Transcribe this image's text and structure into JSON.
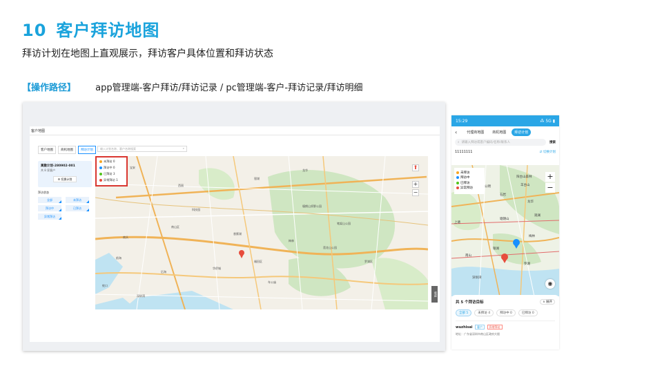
{
  "header": {
    "number": "10",
    "title": "客户拜访地图",
    "subtitle": "拜访计划在地图上直观展示，拜访客户具体位置和拜访状态",
    "path_label": "【操作路径】",
    "path_text": "app管理端-客户拜访/拜访记录 / pc管理端-客户-拜访记录/拜访明细"
  },
  "desktop": {
    "page_title": "客户地图",
    "tabs": [
      {
        "label": "客户地图",
        "active": false
      },
      {
        "label": "商机地图",
        "active": false
      },
      {
        "label": "拜访计划",
        "active": true
      }
    ],
    "search_placeholder": "输入计划名称、客户名称搜索",
    "plan": {
      "name": "离散计划-280902-001",
      "count": "共 8 家客户",
      "switch_label": "⚙ 切换计划"
    },
    "visit_status_label": "拜访状态",
    "status_chips": [
      "全部",
      "未拜访",
      "拜访中",
      "已拜访",
      "异常拜访"
    ],
    "legend": [
      {
        "label": "未拜访 0",
        "color": "#f5a623"
      },
      {
        "label": "拜访中 0",
        "color": "#1890ff"
      },
      {
        "label": "已拜访 3",
        "color": "#52c41a"
      },
      {
        "label": "异常拜访 1",
        "color": "#e74c3c"
      }
    ],
    "map_labels": [
      "宝安",
      "福田区",
      "南山区",
      "罗湖区",
      "深圳湾",
      "后海",
      "前海",
      "西丽",
      "龙华",
      "塘朗山郊野公园",
      "梅林",
      "香蜜湖",
      "南头",
      "蛇口",
      "科技园",
      "华侨城",
      "车公庙",
      "银湖",
      "笔架山公园",
      "莲花山公园"
    ],
    "side_button": "收起"
  },
  "phone": {
    "time": "15:29",
    "signal": "⁂ 5G ▮",
    "tabs": [
      {
        "label": "代理商地图",
        "active": false
      },
      {
        "label": "商机地图",
        "active": false
      },
      {
        "label": "拜访计划",
        "active": true
      }
    ],
    "search_placeholder": "请输入拜访或客户编码/名称/联系人",
    "search_button": "搜索",
    "plan_name": "11111111",
    "switch_plan": "⇄ 切换计划",
    "legend": [
      {
        "label": "未拜访",
        "color": "#f5a623"
      },
      {
        "label": "拜访中",
        "color": "#1890ff"
      },
      {
        "label": "已拜访",
        "color": "#52c41a"
      },
      {
        "label": "异常拜访",
        "color": "#e74c3c"
      }
    ],
    "map_labels": [
      "阳台山森林",
      "羊台山",
      "公明",
      "石岩",
      "龙华",
      "罗湖",
      "南山",
      "深圳湾",
      "塘朗山",
      "观澜",
      "梅林",
      "上塘",
      "银湖"
    ],
    "panel_title": "共 5 个拜访目标",
    "expand_label": "∧ 展开",
    "filters": [
      {
        "label": "全部 5",
        "active": true
      },
      {
        "label": "未拜访 4",
        "active": false
      },
      {
        "label": "拜访中 0",
        "active": false
      },
      {
        "label": "已拜访 0",
        "active": false
      }
    ],
    "card": {
      "name": "wuzhisai",
      "tag1": "客户",
      "tag2": "异常拜访",
      "address": "地址：广东省深圳市南山区政府大楼"
    }
  }
}
